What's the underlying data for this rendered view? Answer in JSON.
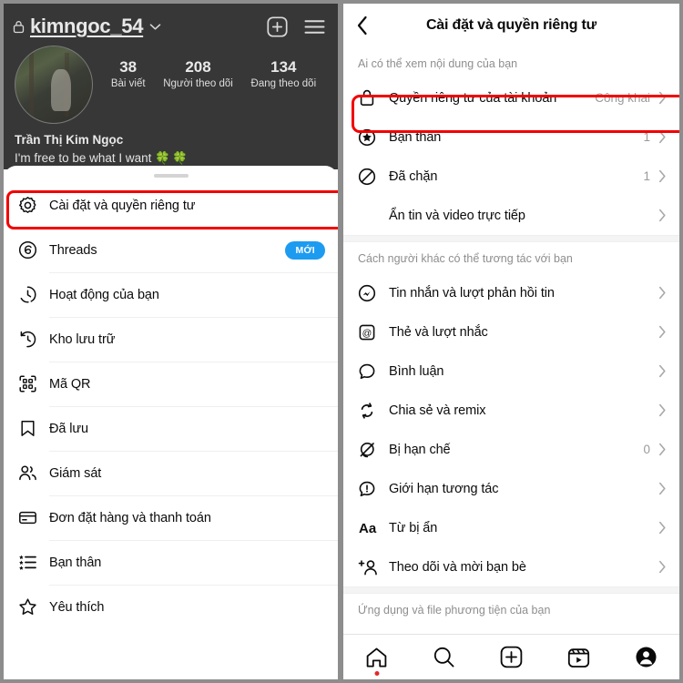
{
  "profile": {
    "username": "kimngoc_54",
    "lock_icon": "lock-icon",
    "chevron_icon": "chevron-down-icon",
    "add_icon": "add-post-icon",
    "menu_icon": "hamburger-menu-icon",
    "stats": [
      {
        "num": "38",
        "label": "Bài viết"
      },
      {
        "num": "208",
        "label": "Người theo dõi"
      },
      {
        "num": "134",
        "label": "Đang theo dõi"
      }
    ],
    "full_name": "Trần Thị Kim Ngọc",
    "bio": "I'm free to be what I want",
    "bio_emoji": "🍀🍀"
  },
  "sheet_menu": {
    "items": [
      {
        "label": "Cài đặt và quyền riêng tư",
        "icon": "settings-gear-icon",
        "badge": "",
        "highlighted": true
      },
      {
        "label": "Threads",
        "icon": "threads-icon",
        "badge": "MỚI",
        "highlighted": false
      },
      {
        "label": "Hoạt động của bạn",
        "icon": "activity-clock-icon",
        "badge": "",
        "highlighted": false
      },
      {
        "label": "Kho lưu trữ",
        "icon": "archive-clock-icon",
        "badge": "",
        "highlighted": false
      },
      {
        "label": "Mã QR",
        "icon": "qr-code-icon",
        "badge": "",
        "highlighted": false
      },
      {
        "label": "Đã lưu",
        "icon": "bookmark-icon",
        "badge": "",
        "highlighted": false
      },
      {
        "label": "Giám sát",
        "icon": "supervision-people-icon",
        "badge": "",
        "highlighted": false
      },
      {
        "label": "Đơn đặt hàng và thanh toán",
        "icon": "credit-card-icon",
        "badge": "",
        "highlighted": false
      },
      {
        "label": "Bạn thân",
        "icon": "close-friends-list-icon",
        "badge": "",
        "highlighted": false
      },
      {
        "label": "Yêu thích",
        "icon": "star-icon",
        "badge": "",
        "highlighted": false
      }
    ]
  },
  "settings": {
    "header": {
      "back_icon": "back-chevron-icon",
      "title": "Cài đặt và quyền riêng tư"
    },
    "sections": [
      {
        "title": "Ai có thể xem nội dung của bạn",
        "rows": [
          {
            "label": "Quyền riêng tư của tài khoản",
            "icon": "lock-icon",
            "value": "Công khai",
            "chevron": true,
            "highlighted": true
          },
          {
            "label": "Bạn thân",
            "icon": "star-circle-icon",
            "value": "1",
            "chevron": true,
            "highlighted": false
          },
          {
            "label": "Đã chặn",
            "icon": "block-icon",
            "value": "1",
            "chevron": true,
            "highlighted": false
          },
          {
            "label": "Ẩn tin và video trực tiếp",
            "icon": "",
            "value": "",
            "chevron": true,
            "highlighted": false
          }
        ]
      },
      {
        "title": "Cách người khác có thể tương tác với bạn",
        "rows": [
          {
            "label": "Tin nhắn và lượt phản hồi tin",
            "icon": "messenger-icon",
            "value": "",
            "chevron": true,
            "highlighted": false
          },
          {
            "label": "Thẻ và lượt nhắc",
            "icon": "at-mention-icon",
            "value": "",
            "chevron": true,
            "highlighted": false
          },
          {
            "label": "Bình luận",
            "icon": "comment-bubble-icon",
            "value": "",
            "chevron": true,
            "highlighted": false
          },
          {
            "label": "Chia sẻ và remix",
            "icon": "share-remix-icon",
            "value": "",
            "chevron": true,
            "highlighted": false
          },
          {
            "label": "Bị hạn chế",
            "icon": "restricted-icon",
            "value": "0",
            "chevron": true,
            "highlighted": false
          },
          {
            "label": "Giới hạn tương tác",
            "icon": "limit-interaction-icon",
            "value": "",
            "chevron": true,
            "highlighted": false
          },
          {
            "label": "Từ bị ẩn",
            "icon": "hidden-words-icon",
            "value": "",
            "chevron": true,
            "highlighted": false
          },
          {
            "label": "Theo dõi và mời bạn bè",
            "icon": "add-person-icon",
            "value": "",
            "chevron": true,
            "highlighted": false
          }
        ]
      },
      {
        "title": "Ứng dụng và file phương tiện của bạn",
        "rows": []
      }
    ]
  },
  "bottom_nav": {
    "items": [
      {
        "icon": "home-icon",
        "dot": true
      },
      {
        "icon": "search-icon",
        "dot": false
      },
      {
        "icon": "create-post-icon",
        "dot": false
      },
      {
        "icon": "reels-icon",
        "dot": false
      },
      {
        "icon": "profile-avatar-icon",
        "dot": false
      }
    ]
  },
  "colors": {
    "accent_blue": "#1d9bf0",
    "highlight_red": "#f20000",
    "notification_dot": "#e02a2a"
  }
}
